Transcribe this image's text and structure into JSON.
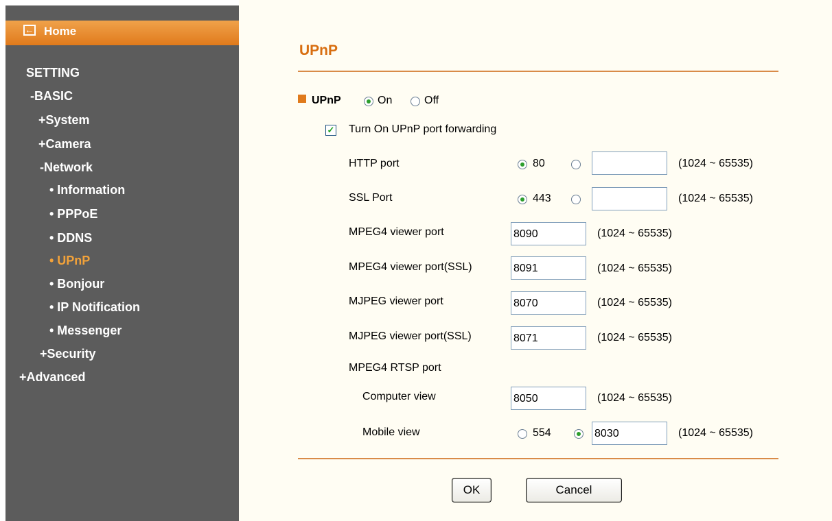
{
  "sidebar": {
    "home_icon": "back-arrow-icon",
    "home": "Home",
    "setting": "SETTING",
    "basic": "-BASIC",
    "system": "+System",
    "camera": "+Camera",
    "network": "-Network",
    "information": "• Information",
    "pppoe": "• PPPoE",
    "ddns": "• DDNS",
    "upnp": "• UPnP",
    "bonjour": "• Bonjour",
    "ip_notification": "• IP Notification",
    "messenger": "• Messenger",
    "security": "+Security",
    "advanced": "+Advanced",
    "active_color": "#f2a23a"
  },
  "main": {
    "title": "UPnP",
    "upnp_label": "UPnP",
    "on": "On",
    "off": "Off",
    "upnp_selected": "On",
    "forwarding_label": "Turn On UPnP port forwarding",
    "forwarding_checked": true,
    "range": "(1024 ~ 65535)",
    "http_label": "HTTP port",
    "http_default": "80",
    "http_custom": "",
    "ssl_label": "SSL Port",
    "ssl_default": "443",
    "ssl_custom": "",
    "mpeg4_label": "MPEG4 viewer port",
    "mpeg4_value": "8090",
    "mpeg4ssl_label": "MPEG4 viewer port(SSL)",
    "mpeg4ssl_value": "8091",
    "mjpeg_label": "MJPEG viewer port",
    "mjpeg_value": "8070",
    "mjpegssl_label": "MJPEG viewer port(SSL)",
    "mjpegssl_value": "8071",
    "rtsp_label": "MPEG4 RTSP port",
    "computer_label": "Computer view",
    "computer_value": "8050",
    "mobile_label": "Mobile view",
    "mobile_default": "554",
    "mobile_value": "8030",
    "ok": "OK",
    "cancel": "Cancel",
    "accent_color": "#d86e10"
  }
}
